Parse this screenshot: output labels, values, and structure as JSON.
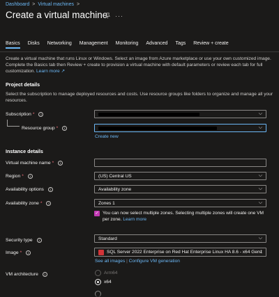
{
  "breadcrumb": {
    "items": [
      "Dashboard",
      "Virtual machines"
    ],
    "separator": ">"
  },
  "page": {
    "title": "Create a virtual machine",
    "pin_icon": "pin-icon",
    "more_icon": "more-icon"
  },
  "tabs": [
    {
      "label": "Basics",
      "active": true
    },
    {
      "label": "Disks"
    },
    {
      "label": "Networking"
    },
    {
      "label": "Management"
    },
    {
      "label": "Monitoring"
    },
    {
      "label": "Advanced"
    },
    {
      "label": "Tags"
    },
    {
      "label": "Review + create"
    }
  ],
  "intro": {
    "text": "Create a virtual machine that runs Linux or Windows. Select an image from Azure marketplace or use your own customized image. Complete the Basics tab then Review + create to provision a virtual machine with default parameters or review each tab for full customization.",
    "learn_more": "Learn more"
  },
  "project": {
    "title": "Project details",
    "description": "Select the subscription to manage deployed resources and costs. Use resource groups like folders to organize and manage all your resources.",
    "subscription_label": "Subscription",
    "resource_group_label": "Resource group",
    "create_new": "Create new"
  },
  "instance": {
    "title": "Instance details",
    "vm_name_label": "Virtual machine name",
    "vm_name_value": "",
    "region_label": "Region",
    "region_value": "(US) Central US",
    "availability_options_label": "Availability options",
    "availability_options_value": "Availability zone",
    "availability_zone_label": "Availability zone",
    "availability_zone_value": "Zones 1",
    "zone_note": "You can now select multiple zones. Selecting multiple zones will create one VM per zone.",
    "zone_learn_more": "Learn more",
    "security_type_label": "Security type",
    "security_type_value": "Standard",
    "image_label": "Image",
    "image_value": "SQL Server 2022 Enterprise on Red Hat Enterprise Linux HA 8.6 - x64 Gen1",
    "see_all_images": "See all images",
    "configure_vm_generation": "Configure VM generation",
    "divider": "|",
    "vm_arch_label": "VM architecture",
    "arch_options": [
      "Arm64",
      "x64"
    ],
    "arch_selected": "x64"
  },
  "colors": {
    "accent": "#6cb8f6",
    "background": "#1b1a19",
    "required": "#f1707b",
    "checkbox": "#c239b3"
  }
}
